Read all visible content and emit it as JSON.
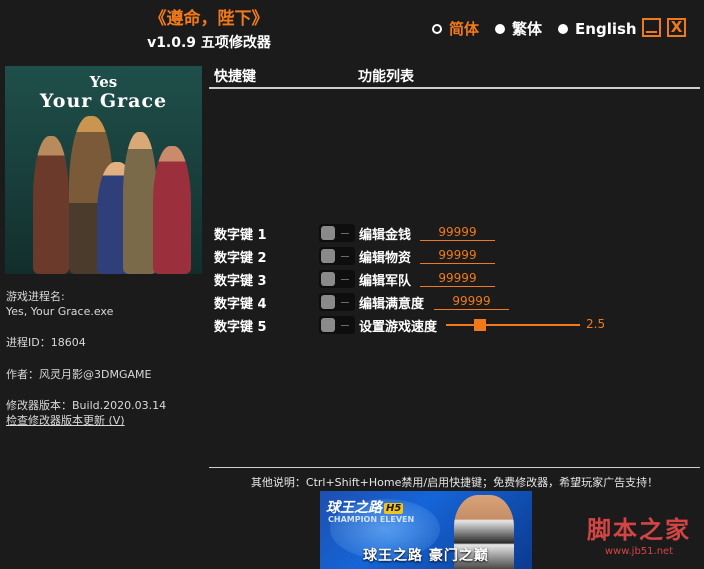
{
  "header": {
    "game_title": "《遵命，陛下》",
    "version_line": "v1.0.9 五项修改器"
  },
  "languages": [
    {
      "label": "简体",
      "active": true
    },
    {
      "label": "繁体",
      "active": false
    },
    {
      "label": "English",
      "active": false
    }
  ],
  "window_controls": {
    "close_glyph": "X"
  },
  "cover": {
    "logo_line1": "Yes",
    "logo_line2": "Your Grace"
  },
  "info": {
    "process_label": "游戏进程名:",
    "process_name": "Yes, Your Grace.exe",
    "pid_line": "进程ID：18604",
    "author_line": "作者：风灵月影@3DMGAME",
    "build_line": "修改器版本：Build.2020.03.14",
    "update_link": "检查修改器版本更新 (V)"
  },
  "columns": {
    "hotkey": "快捷键",
    "function": "功能列表"
  },
  "cheats": [
    {
      "hotkey": "数字键 1",
      "function": "编辑金钱",
      "value": "99999",
      "enabled": false
    },
    {
      "hotkey": "数字键 2",
      "function": "编辑物资",
      "value": "99999",
      "enabled": false
    },
    {
      "hotkey": "数字键 3",
      "function": "编辑军队",
      "value": "99999",
      "enabled": false
    },
    {
      "hotkey": "数字键 4",
      "function": "编辑满意度",
      "value": "99999",
      "enabled": false
    },
    {
      "hotkey": "数字键 5",
      "function": "设置游戏速度",
      "value": "2.5",
      "enabled": false
    }
  ],
  "footer": {
    "notice": "其他说明：Ctrl+Shift+Home禁用/启用快捷键；免费修改器，希望玩家广告支持！"
  },
  "banner": {
    "top_text": "球王之路",
    "badge": "H5",
    "sub_text": "CHAMPION ELEVEN",
    "bottom_text": "球王之路 豪门之巅"
  },
  "watermark": {
    "text": "脚本之家",
    "url": "www.jb51.net"
  },
  "colors": {
    "accent": "#f07a1b",
    "background": "#1b1b1b",
    "text": "#e6e6e6"
  }
}
